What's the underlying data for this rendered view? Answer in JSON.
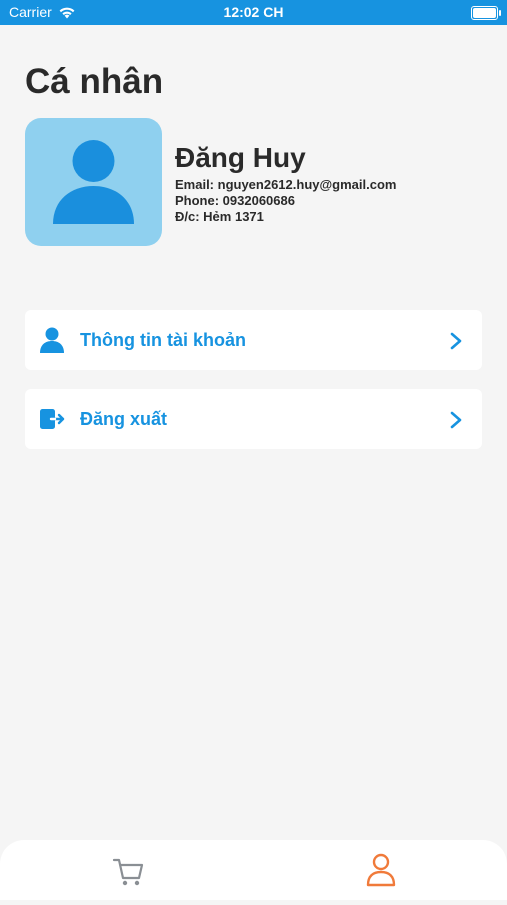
{
  "status_bar": {
    "carrier": "Carrier",
    "time": "12:02 CH",
    "wifi_icon": "wifi-icon",
    "battery_icon": "battery-icon"
  },
  "page": {
    "title": "Cá nhân"
  },
  "profile": {
    "avatar_icon": "user-avatar-icon",
    "name": "Đăng Huy",
    "email": "Email: nguyen2612.huy@gmail.com",
    "phone": "Phone: 0932060686",
    "address": "Đ/c: Hẻm 1371"
  },
  "menu": [
    {
      "label": "Thông tin tài khoản",
      "icon": "person-icon"
    },
    {
      "label": "Đăng xuất",
      "icon": "logout-icon"
    }
  ],
  "tab_bar": {
    "tabs": [
      {
        "name": "cart",
        "icon": "cart-icon",
        "active": false
      },
      {
        "name": "profile",
        "icon": "profile-icon",
        "active": true
      }
    ]
  },
  "colors": {
    "accent": "#1793e0",
    "active_tab": "#f07a3a",
    "avatar_bg": "#8fd0ef",
    "background": "#f5f5f5"
  }
}
